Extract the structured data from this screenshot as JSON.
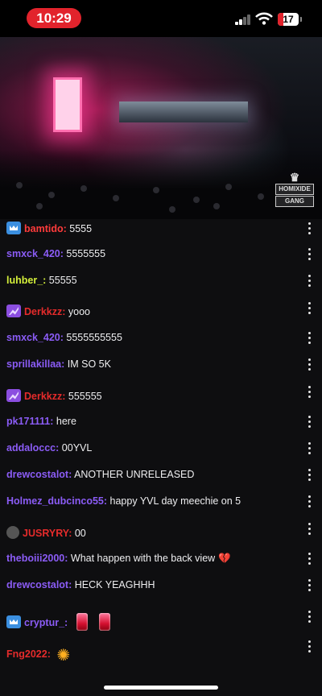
{
  "status_bar": {
    "time": "10:29",
    "battery": "17",
    "accent_color": "#e2232c"
  },
  "video": {
    "overlay_logo_text": [
      "HOMIXIDE",
      "GANG"
    ]
  },
  "chat": {
    "messages": [
      {
        "badge": "crown-badge",
        "user": "bamtido:",
        "text": "5555",
        "color": "#ff3b3b"
      },
      {
        "badge": null,
        "user": "smxck_420:",
        "text": "5555555",
        "color": "#8b5cf6"
      },
      {
        "badge": null,
        "user": "luhber_:",
        "text": "55555",
        "color": "#d4ef3a"
      },
      {
        "badge": "purple-badge",
        "user": "Derkkzz:",
        "text": "yooo",
        "color": "#e52b2b"
      },
      {
        "badge": null,
        "user": "smxck_420:",
        "text": "5555555555",
        "color": "#8b5cf6"
      },
      {
        "badge": null,
        "user": "sprillakillaa:",
        "text": "IM SO 5K",
        "color": "#8b5cf6"
      },
      {
        "badge": "purple-badge",
        "user": "Derkkzz:",
        "text": "555555",
        "color": "#e52b2b"
      },
      {
        "badge": null,
        "user": "pk171111:",
        "text": "here",
        "color": "#8b5cf6"
      },
      {
        "badge": null,
        "user": "addaloccc:",
        "text": "00YVL",
        "color": "#8b5cf6"
      },
      {
        "badge": null,
        "user": "drewcostalot:",
        "text": "ANOTHER UNRELEASED",
        "color": "#8b5cf6"
      },
      {
        "badge": null,
        "user": "Holmez_dubcinco55:",
        "text": "happy YVL day meechie on 5",
        "color": "#8b5cf6"
      },
      {
        "badge": "avatar-badge",
        "user": "JUSRYRY:",
        "text": "00",
        "color": "#e52b2b"
      },
      {
        "badge": null,
        "user": "theboiii2000:",
        "text": "What happen with the back view",
        "color": "#8b5cf6"
      },
      {
        "badge": null,
        "user": "drewcostalot:",
        "text": "HECK YEAGHHH",
        "color": "#8b5cf6"
      },
      {
        "badge": "crown-badge",
        "user": "cryptur_:",
        "text": "",
        "color": "#8b5cf6"
      },
      {
        "badge": null,
        "user": "Fng2022:",
        "text": "",
        "color": "#e52b2b"
      }
    ]
  }
}
